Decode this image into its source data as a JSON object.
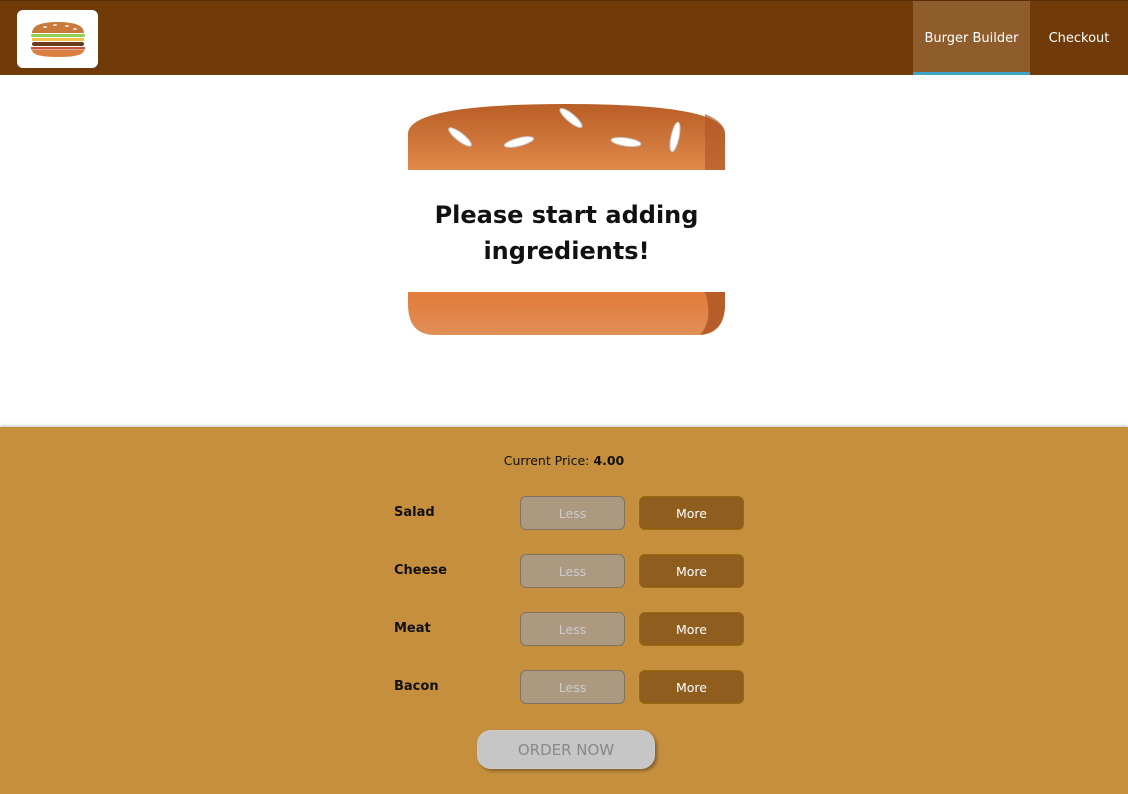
{
  "nav": {
    "items": [
      {
        "label": "Burger Builder",
        "active": true
      },
      {
        "label": "Checkout",
        "active": false
      }
    ]
  },
  "burger": {
    "message": "Please start adding ingredients!"
  },
  "controls": {
    "price_label": "Current Price:",
    "price_value": "4.00",
    "ingredients": [
      {
        "label": "Salad",
        "less": "Less",
        "more": "More"
      },
      {
        "label": "Cheese",
        "less": "Less",
        "more": "More"
      },
      {
        "label": "Meat",
        "less": "Less",
        "more": "More"
      },
      {
        "label": "Bacon",
        "less": "Less",
        "more": "More"
      }
    ],
    "order_label": "ORDER NOW"
  },
  "colors": {
    "toolbar": "#703b09",
    "nav_active": "#8f5c2c",
    "nav_active_underline": "#40a4c8",
    "controls_bg": "#c68f3e",
    "more_button": "#8f5e1e",
    "less_button_disabled": "#ac9980",
    "bread": "#e27b36"
  }
}
